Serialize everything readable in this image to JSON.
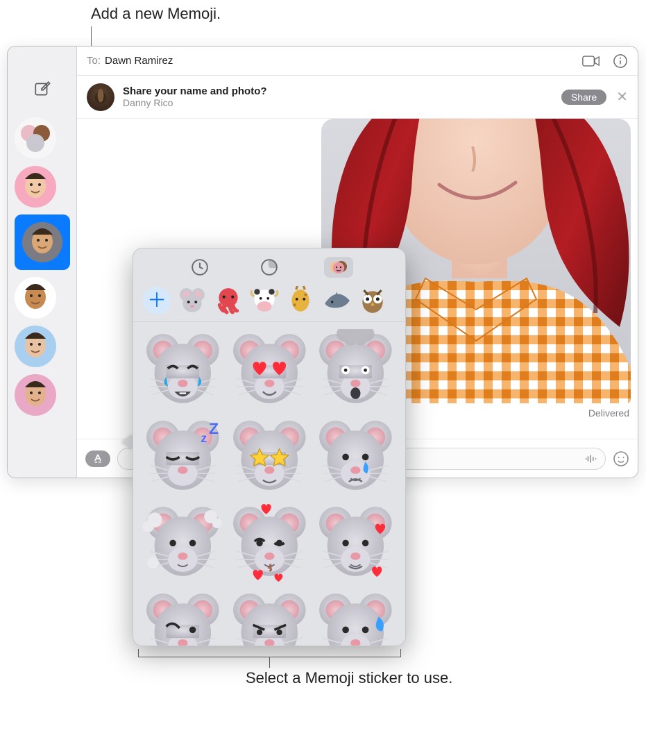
{
  "callouts": {
    "top": "Add a new Memoji.",
    "bottom": "Select a Memoji sticker to use."
  },
  "window": {
    "to_label": "To:",
    "recipient": "Dawn Ramirez",
    "banner": {
      "title": "Share your name and photo?",
      "subtitle": "Danny Rico",
      "share_label": "Share",
      "close_glyph": "✕"
    },
    "delivered_text": "Delivered"
  },
  "sidebar": {
    "items": [
      {
        "name": "group-chat",
        "bg": "#f6f6f7",
        "type": "group"
      },
      {
        "name": "memoji-pink",
        "bg": "#f7a9c0",
        "type": "memoji",
        "face": "#f2c9a6"
      },
      {
        "name": "dawn-ramirez",
        "bg": "#7b7b83",
        "type": "memoji",
        "face": "#d9a876",
        "selected": true
      },
      {
        "name": "memoji-glasses",
        "bg": "#ffffff",
        "type": "memoji",
        "face": "#c78a50"
      },
      {
        "name": "photo-contact-1",
        "bg": "#a9cff0",
        "type": "photo",
        "face": "#e8c3a3"
      },
      {
        "name": "photo-contact-2",
        "bg": "#e9a9c6",
        "type": "photo",
        "face": "#e3b28d"
      }
    ]
  },
  "popover": {
    "tabs": [
      {
        "name": "recents",
        "selected": false
      },
      {
        "name": "stickers",
        "selected": false
      },
      {
        "name": "memoji",
        "selected": true
      }
    ],
    "characters": [
      {
        "name": "mouse"
      },
      {
        "name": "octopus"
      },
      {
        "name": "cow"
      },
      {
        "name": "giraffe"
      },
      {
        "name": "shark"
      },
      {
        "name": "owl"
      }
    ],
    "stickers": [
      {
        "name": "mouse-laughing-tears",
        "accent": "#2aa6e9"
      },
      {
        "name": "mouse-heart-eyes",
        "accent": "#ff2d3a"
      },
      {
        "name": "mouse-mind-blown",
        "accent": "#b9b9bf"
      },
      {
        "name": "mouse-sleeping",
        "accent": "#4a6dff"
      },
      {
        "name": "mouse-star-eyes",
        "accent": "#ffd23a"
      },
      {
        "name": "mouse-tear",
        "accent": "#3aa0ff"
      },
      {
        "name": "mouse-head-clouds",
        "accent": "#e9e9ee"
      },
      {
        "name": "mouse-blowing-kiss-hearts",
        "accent": "#ff2d3a"
      },
      {
        "name": "mouse-hearts-around",
        "accent": "#ff2d3a"
      },
      {
        "name": "mouse-confused",
        "accent": ""
      },
      {
        "name": "mouse-angry",
        "accent": ""
      },
      {
        "name": "mouse-sweat",
        "accent": "#3aa0ff"
      }
    ]
  },
  "colors": {
    "accent_blue": "#0a7aff",
    "mouse_body": "#c9c8d0",
    "mouse_inner_ear": "#e6b6bf",
    "mouse_nose": "#e79aa6"
  }
}
